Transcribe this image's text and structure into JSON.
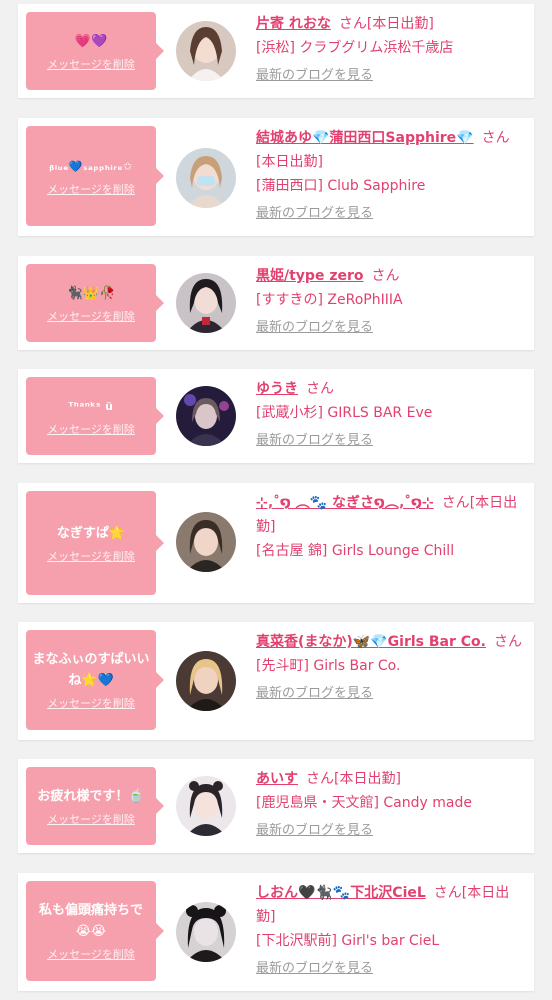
{
  "delete_label": "メッセージを削除",
  "blog_label": "最新のブログを見る",
  "san_label": "さん",
  "colors": {
    "accent": "#e2416f",
    "bubble": "#f7a0ad",
    "card": "#ffffff",
    "background": "#f1f1f1",
    "muted": "#9b9b9b"
  },
  "items": [
    {
      "message": "💗💜",
      "name": "片寄 れおな",
      "status": "[本日出勤]",
      "area": "[浜松]",
      "shop": "クラブグリム浜松千歳店"
    },
    {
      "message": "ᵦₗᵤₑ💙ₛₐₚₚₕᵢᵣₑ✩",
      "name": "結城あゆ💎蒲田西口Sapphire💎",
      "status": "[本日出勤]",
      "area": "[蒲田西口]",
      "shop": "Club Sapphire"
    },
    {
      "message": "🐈‍⬛👑🥀",
      "name": "黒姫/type zero",
      "status": "",
      "area": "[すすきの]",
      "shop": "ZeRoPhIIIA"
    },
    {
      "message": "ᵀʰᵃⁿᵏˢ ü",
      "name": "ゆうき",
      "status": "",
      "area": "[武蔵小杉]",
      "shop": "GIRLS BAR Eve"
    },
    {
      "message": "なぎすぱ🌟",
      "name": "⊹‚˚໑ ︵🐾 なぎさ໑︵‚˚໑⊹",
      "status": "[本日出勤]",
      "area": "[名古屋 錦]",
      "shop": "Girls Lounge Chill"
    },
    {
      "message": "まなふぃのすぱいいね🌟💙",
      "name": "真菜香(まなか)🦋💎Girls Bar Co.",
      "status": "",
      "area": "[先斗町]",
      "shop": "Girls Bar Co."
    },
    {
      "message": "お疲れ様です！🍵",
      "name": "あいす",
      "status": "[本日出勤]",
      "area": "[鹿児島県・天文館]",
      "shop": "Candy made"
    },
    {
      "message": "私も偏頭痛持ちで😭😭",
      "name": "しおん🖤🐈‍⬛🐾下北沢CieL",
      "status": "[本日出勤]",
      "area": "[下北沢駅前]",
      "shop": "Girl's bar CieL"
    }
  ]
}
